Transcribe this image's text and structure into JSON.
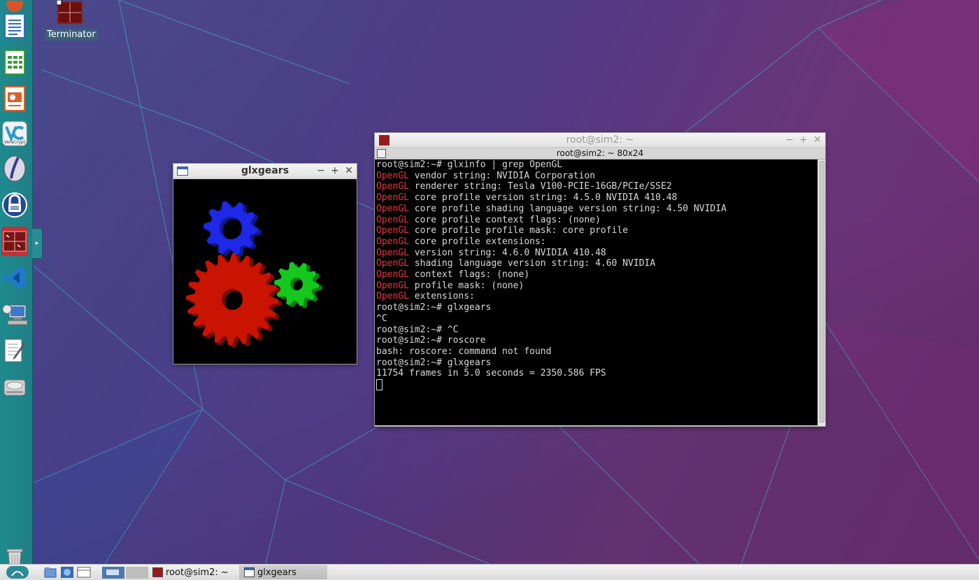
{
  "desktop": {
    "icon_label": "Terminator"
  },
  "glxgears": {
    "title": "glxgears"
  },
  "terminal": {
    "window_title": "root@sim2: ~",
    "tab_title": "root@sim2: ~ 80x24",
    "lines": [
      {
        "prefix": "",
        "text": "root@sim2:~# glxinfo | grep OpenGL"
      },
      {
        "prefix": "OpenGL",
        "text": " vendor string: NVIDIA Corporation"
      },
      {
        "prefix": "OpenGL",
        "text": " renderer string: Tesla V100-PCIE-16GB/PCIe/SSE2"
      },
      {
        "prefix": "OpenGL",
        "text": " core profile version string: 4.5.0 NVIDIA 410.48"
      },
      {
        "prefix": "OpenGL",
        "text": " core profile shading language version string: 4.50 NVIDIA"
      },
      {
        "prefix": "OpenGL",
        "text": " core profile context flags: (none)"
      },
      {
        "prefix": "OpenGL",
        "text": " core profile profile mask: core profile"
      },
      {
        "prefix": "OpenGL",
        "text": " core profile extensions:"
      },
      {
        "prefix": "OpenGL",
        "text": " version string: 4.6.0 NVIDIA 410.48"
      },
      {
        "prefix": "OpenGL",
        "text": " shading language version string: 4.60 NVIDIA"
      },
      {
        "prefix": "OpenGL",
        "text": " context flags: (none)"
      },
      {
        "prefix": "OpenGL",
        "text": " profile mask: (none)"
      },
      {
        "prefix": "OpenGL",
        "text": " extensions:"
      },
      {
        "prefix": "",
        "text": "root@sim2:~# glxgears"
      },
      {
        "prefix": "",
        "text": "^C"
      },
      {
        "prefix": "",
        "text": "root@sim2:~# ^C"
      },
      {
        "prefix": "",
        "text": "root@sim2:~# roscore"
      },
      {
        "prefix": "",
        "text": "bash: roscore: command not found"
      },
      {
        "prefix": "",
        "text": "root@sim2:~# glxgears"
      },
      {
        "prefix": "",
        "text": "11754 frames in 5.0 seconds = 2350.586 FPS"
      }
    ]
  },
  "taskbar": {
    "tasks": [
      {
        "label": "root@sim2: ~",
        "active": false
      },
      {
        "label": "glxgears",
        "active": true
      }
    ]
  },
  "colors": {
    "opengl_prefix": "#e23a3a",
    "dock": "#1e8a8e",
    "gear_red": "#c81400",
    "gear_green": "#14c81e",
    "gear_blue": "#1e28e6"
  },
  "dock": {
    "icons": [
      "writer-doc-icon",
      "calc-sheet-icon",
      "impress-slides-icon",
      "veracrypt-icon",
      "jedit-icon",
      "keepass-lock-icon",
      "terminator-icon",
      "vscode-icon",
      "network-computer-icon",
      "text-editor-icon",
      "disk-drive-icon",
      "trash-icon"
    ]
  }
}
